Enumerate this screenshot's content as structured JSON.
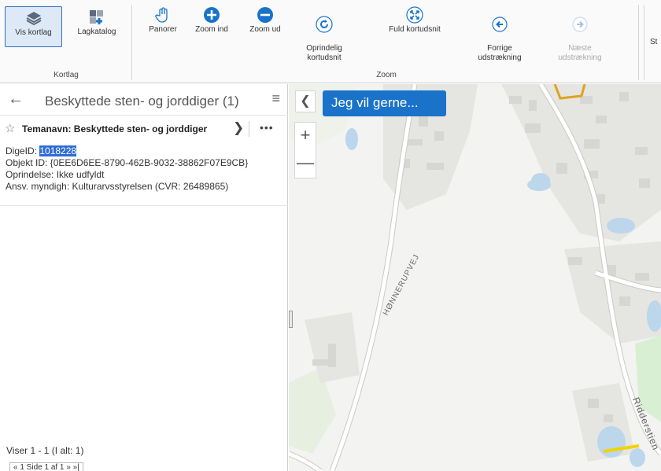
{
  "ribbon": {
    "groups": [
      {
        "label": "Kortlag"
      },
      {
        "label": "Zoom"
      }
    ],
    "buttons": [
      {
        "label": "Vis kortlag",
        "icon": "layers-icon"
      },
      {
        "label": "Lagkatalog",
        "icon": "layer-catalog-icon"
      },
      {
        "label": "Panorer",
        "icon": "pan-hand-icon"
      },
      {
        "label": "Zoom ind",
        "icon": "zoom-in-icon"
      },
      {
        "label": "Zoom ud",
        "icon": "zoom-out-icon"
      },
      {
        "label": "Oprindelig\nkortudsnit",
        "icon": "reset-extent-icon"
      },
      {
        "label": "Fuld kortudsnit",
        "icon": "full-extent-icon"
      },
      {
        "label": "Forrige\nudstrækning",
        "icon": "previous-extent-icon"
      },
      {
        "label": "Næste\nudstrækning",
        "icon": "next-extent-icon"
      },
      {
        "label": "St",
        "icon": ""
      }
    ]
  },
  "panel": {
    "title": "Beskyttede sten- og jorddiger (1)",
    "feature_title": "Temanavn: Beskyttede sten- og jorddiger",
    "attributes": {
      "dige_label": "DigeID: ",
      "dige_value": "1018228",
      "objekt": "Objekt ID: {0EE6D6EE-8790-462B-9032-38862F07E9CB}",
      "oprindelse": "Oprindelse: Ikke udfyldt",
      "ansv": "Ansv. myndigh: Kulturarvsstyrelsen (CVR: 26489865)"
    },
    "count_text": "Viser 1 - 1 (I alt: 1)",
    "pager_text": "«   1   Side 1 af 1  »   »|"
  },
  "map": {
    "want_button": "Jeg vil gerne...",
    "road_hoennerupvej": "HØNNERUPVEJ",
    "road_ridderstien": "Ridderstien"
  },
  "colors": {
    "accent": "#1a73c9",
    "highlight": "#2e6bd6",
    "water": "#bcd6ec",
    "green": "#d4edcf",
    "building": "#d9d9d5",
    "road": "#ffffff",
    "parcel_outline": "#e0a21e"
  }
}
